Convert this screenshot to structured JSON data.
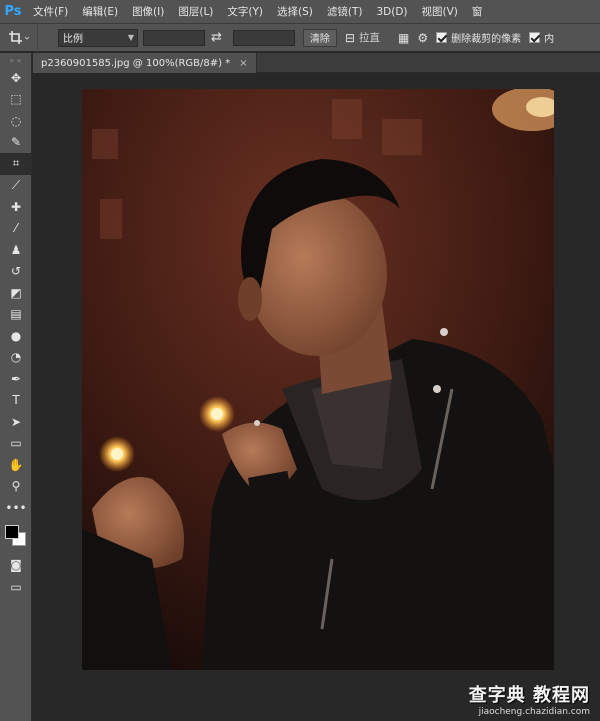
{
  "app": {
    "logo": "Ps",
    "menu": [
      "文件(F)",
      "编辑(E)",
      "图像(I)",
      "图层(L)",
      "文字(Y)",
      "选择(S)",
      "滤镜(T)",
      "3D(D)",
      "视图(V)",
      "窗"
    ]
  },
  "options": {
    "ratio_value": "比例",
    "clear_label": "清除",
    "straighten_label": "拉直",
    "delete_cropped_label": "删除裁剪的像素",
    "content_aware_label": "内"
  },
  "document": {
    "tab_title": "p2360901585.jpg @ 100%(RGB/8#) *",
    "close_glyph": "×"
  },
  "toolbox": {
    "tools": [
      {
        "name": "move-tool-icon",
        "glyph": "✥"
      },
      {
        "name": "marquee-tool-icon",
        "glyph": "⬚"
      },
      {
        "name": "lasso-tool-icon",
        "glyph": "◌"
      },
      {
        "name": "quick-selection-tool-icon",
        "glyph": "✎"
      },
      {
        "name": "crop-tool-icon",
        "glyph": "⌗",
        "active": true
      },
      {
        "name": "eyedropper-tool-icon",
        "glyph": "⟋"
      },
      {
        "name": "healing-brush-tool-icon",
        "glyph": "✚"
      },
      {
        "name": "brush-tool-icon",
        "glyph": "⁄"
      },
      {
        "name": "clone-stamp-tool-icon",
        "glyph": "♟"
      },
      {
        "name": "history-brush-tool-icon",
        "glyph": "↺"
      },
      {
        "name": "eraser-tool-icon",
        "glyph": "◩"
      },
      {
        "name": "gradient-tool-icon",
        "glyph": "▤"
      },
      {
        "name": "blur-tool-icon",
        "glyph": "●"
      },
      {
        "name": "dodge-tool-icon",
        "glyph": "◔"
      },
      {
        "name": "pen-tool-icon",
        "glyph": "✒"
      },
      {
        "name": "type-tool-icon",
        "glyph": "T"
      },
      {
        "name": "path-selection-tool-icon",
        "glyph": "➤"
      },
      {
        "name": "rectangle-tool-icon",
        "glyph": "▭"
      },
      {
        "name": "hand-tool-icon",
        "glyph": "✋"
      },
      {
        "name": "zoom-tool-icon",
        "glyph": "⚲"
      },
      {
        "name": "more-tools-icon",
        "glyph": "•••"
      }
    ]
  },
  "watermark": {
    "title": "查字典 教程网",
    "url": "jiaocheng.chazidian.com"
  },
  "colors": {
    "accent": "#31a8ff",
    "panel": "#535353",
    "workspace": "#282828"
  }
}
